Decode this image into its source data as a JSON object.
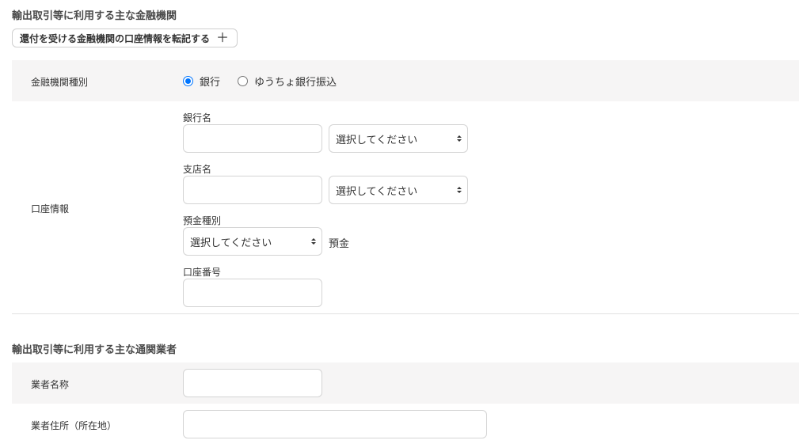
{
  "bank_section": {
    "title": "輸出取引等に利用する主な金融機関",
    "transfer_button_label": "還付を受ける金融機関の口座情報を転記する",
    "institution_type": {
      "label": "金融機関種別",
      "options": [
        {
          "label": "銀行",
          "checked": true
        },
        {
          "label": "ゆうちょ銀行振込",
          "checked": false
        }
      ]
    },
    "account_info": {
      "label": "口座情報",
      "bank_name_label": "銀行名",
      "bank_name_value": "",
      "bank_type_select": "選択してください",
      "branch_name_label": "支店名",
      "branch_name_value": "",
      "branch_type_select": "選択してください",
      "deposit_type_label": "預金種別",
      "deposit_type_select": "選択してください",
      "deposit_suffix": "預金",
      "account_number_label": "口座番号",
      "account_number_value": ""
    }
  },
  "broker_section": {
    "title": "輸出取引等に利用する主な通関業者",
    "broker_name_label": "業者名称",
    "broker_name_value": "",
    "broker_address_label": "業者住所（所在地）",
    "broker_address_value": ""
  },
  "colors": {
    "accent": "#0075ff",
    "row_shade": "#f6f5f5",
    "border": "#d4d4d4"
  }
}
